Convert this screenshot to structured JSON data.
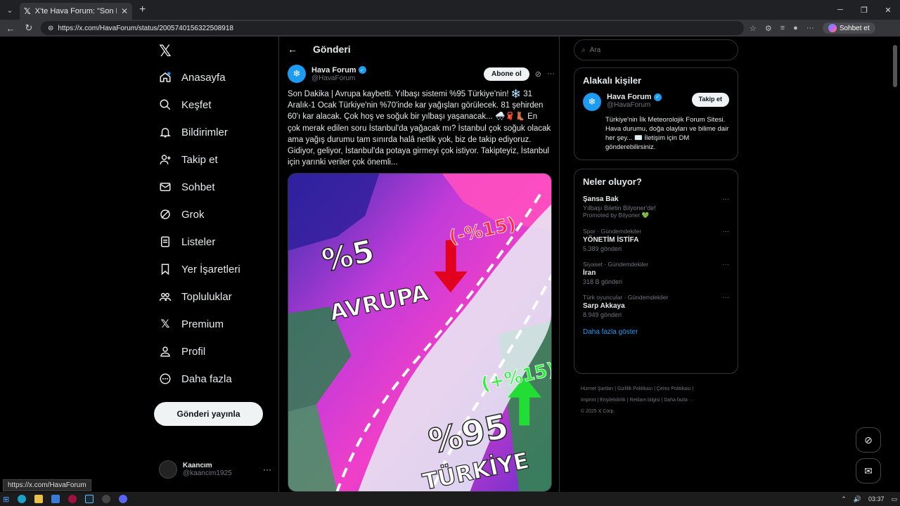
{
  "browser": {
    "tab_title": "X'te Hava Forum: \"Son Dakika | Av",
    "url": "https://x.com/HavaForum/status/2005740156322508918",
    "sohbet_label": "Sohbet et",
    "status_url": "https://x.com/HavaForum"
  },
  "nav": {
    "items": [
      {
        "label": "Anasayfa"
      },
      {
        "label": "Keşfet"
      },
      {
        "label": "Bildirimler"
      },
      {
        "label": "Takip et"
      },
      {
        "label": "Sohbet"
      },
      {
        "label": "Grok"
      },
      {
        "label": "Listeler"
      },
      {
        "label": "Yer İşaretleri"
      },
      {
        "label": "Topluluklar"
      },
      {
        "label": "Premium"
      },
      {
        "label": "Profil"
      },
      {
        "label": "Daha fazla"
      }
    ],
    "post_button": "Gönderi yayınla",
    "account": {
      "name": "Kaancım",
      "handle": "@kaancim1925"
    }
  },
  "post": {
    "header_title": "Gönderi",
    "author_name": "Hava Forum",
    "author_handle": "@HavaForum",
    "subscribe_label": "Abone ol",
    "text": "Son Dakika | Avrupa kaybetti. Yılbaşı sistemi %95 Türkiye'nin! ❄️ 31 Aralık-1 Ocak Türkiye'nin %70'inde kar yağışları görülecek. 81 şehirden 60'ı kar alacak. Çok hoş ve soğuk bir yılbaşı yaşanacak... 🌨️🧣👢 En çok merak edilen soru İstanbul'da yağacak mı? İstanbul çok soğuk olacak ama yağış durumu tam sınırda halâ netlik yok, biz de takip ediyoruz. Gidiyor, geliyor, İstanbul'da potaya girmeyi çok istiyor. Takipteyiz, İstanbul için yarınki veriler çok önemli...",
    "image": {
      "left_pct": "%5",
      "left_label": "AVRUPA",
      "left_change": "(-%15)",
      "right_change": "(+%15)",
      "right_pct": "%95",
      "right_label": "TÜRKİYE"
    }
  },
  "right": {
    "search_placeholder": "Ara",
    "relevant_title": "Alakalı kişiler",
    "person": {
      "name": "Hava Forum",
      "handle": "@HavaForum",
      "follow_label": "Takip et",
      "bio": "Türkiye'nin İlk Meteorolojik Forum Sitesi. Hava durumu, doğa olayları ve bilime dair her şey... ✉️ İletişim için DM gönderebilirsiniz."
    },
    "trends_title": "Neler oluyor?",
    "trends": [
      {
        "meta": "",
        "topic": "Şansa Bak",
        "sub": "Yılbaşı Biletin Bilyoner'de!",
        "extra": "Promoted by Bilyoner 💚"
      },
      {
        "meta": "Spor · Gündemdekiler",
        "topic": "YÖNETİM İSTİFA",
        "sub": "5.389 gönderi",
        "extra": ""
      },
      {
        "meta": "Siyaset · Gündemdekiler",
        "topic": "İran",
        "sub": "318 B gönderi",
        "extra": ""
      },
      {
        "meta": "Türk oyuncular · Gündemdekiler",
        "topic": "Sarp Akkaya",
        "sub": "8.949 gönderi",
        "extra": ""
      }
    ],
    "show_more": "Daha fazla göster",
    "footer_line1": "Hizmet Şartları  |  Gizlilik Politikası  |  Çerez Politikası  |",
    "footer_line2": "Imprint  |  Erişilebilirlik  |  Reklam bilgisi  |  Daha fazla ···",
    "footer_line3": "© 2025 X Corp."
  },
  "taskbar": {
    "time": "03:37"
  }
}
